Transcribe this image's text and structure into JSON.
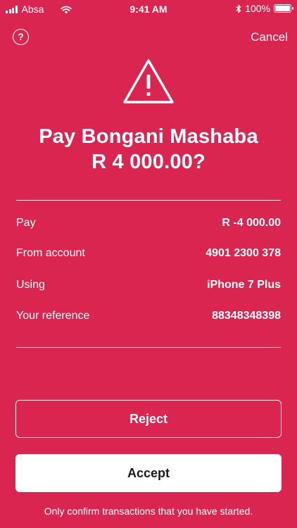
{
  "status_bar": {
    "carrier": "Absa",
    "time": "9:41 AM",
    "battery": "100%"
  },
  "nav": {
    "help_label": "?",
    "cancel_label": "Cancel"
  },
  "title": {
    "line1": "Pay Bongani Mashaba",
    "line2": "R 4 000.00?"
  },
  "details": [
    {
      "label": "Pay",
      "value": "R -4 000.00"
    },
    {
      "label": "From account",
      "value": "4901 2300 378"
    },
    {
      "label": "Using",
      "value": "iPhone 7 Plus"
    },
    {
      "label": "Your reference",
      "value": "88348348398"
    }
  ],
  "actions": {
    "reject_label": "Reject",
    "accept_label": "Accept"
  },
  "footer": {
    "note": "Only confirm transactions that you have started."
  },
  "colors": {
    "background": "#DA2550",
    "accept_bg": "#FFFFFF",
    "text": "#FFFFFF"
  }
}
